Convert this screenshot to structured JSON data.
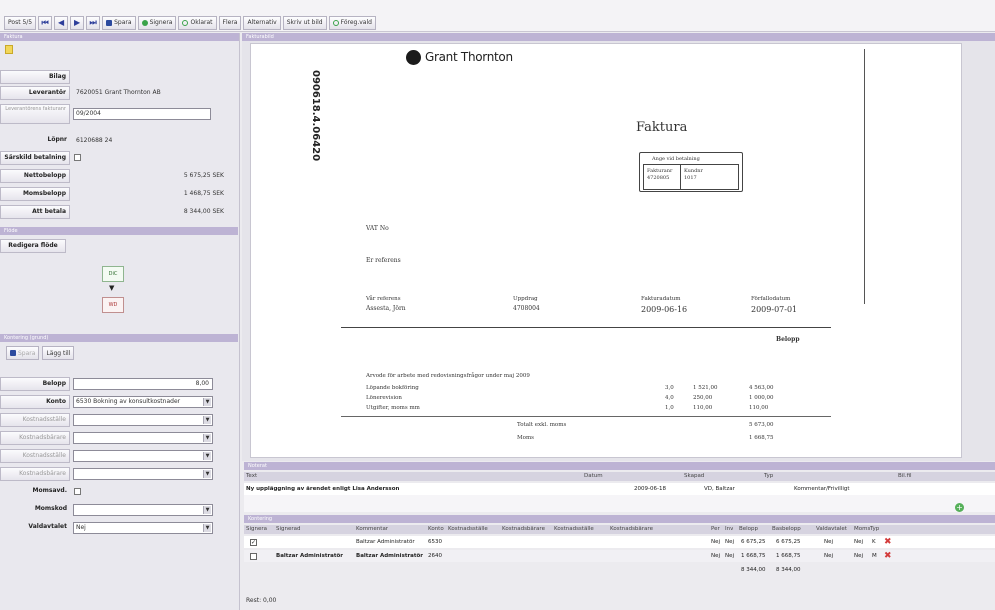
{
  "toolbar": {
    "post_label": "Post 5/5",
    "first_label": "⏮",
    "prev_label": "◀",
    "next_label": "▶",
    "last_label": "⏭",
    "save_label": "Spara",
    "signera_label": "Signera",
    "oklart_label": "Oklarat",
    "flera_label": "Flera",
    "alternativ_label": "Alternativ",
    "skriv_label": "Skriv ut bild",
    "forrige_label": "Föreg.vald"
  },
  "left": {
    "faktura_header": "Faktura",
    "bild_label": "Bilag",
    "leverantor_label": "Leverantör",
    "leverantor_value": "7620051 Grant Thornton AB",
    "levfaktnr_label": "Leverantörens fakturanr",
    "levfaktnr_value": "09/2004",
    "lopnr_label": "Löpnr",
    "lopnr_value": "6120688 24",
    "sarskild_label": "Särskild betalning",
    "netto_label": "Nettobelopp",
    "netto_value": "5 675,25 SEK",
    "moms_label": "Momsbelopp",
    "moms_value": "1 468,75 SEK",
    "att_betala_label": "Att betala",
    "att_betala_value": "8 344,00 SEK",
    "flode_header": "Flöde",
    "redigera_flode": "Redigera flöde",
    "node_top": "DiC",
    "node_bottom": "WD",
    "kontering_header": "Kontering (grund)",
    "spara_btn": "Spara",
    "lagg_till_btn": "Lägg till",
    "belopp_label": "Belopp",
    "belopp_value": "8,00",
    "konto_label": "Konto",
    "konto_value": "6530 Bokning av konsultkostnader",
    "kostnadsstalle1_label": "Kostnadsställe",
    "kostnadsbarare1_label": "Kostnadsbärare",
    "kostnadsstalle2_label": "Kostnadsställe",
    "kostnadsbarare2_label": "Kostnadsbärare",
    "momsavd_label": "Momsavd.",
    "momskod_label": "Momskod",
    "valdaskatt_label": "Valdavtalet",
    "valdaskatt_value": "Nej"
  },
  "doc_header": "Fakturabild",
  "doc": {
    "brand": "Grant Thornton",
    "side_number": "090618.4.06420",
    "title": "Faktura",
    "ange_label": "Ange vid betalning",
    "fakturanr_label": "Fakturanr",
    "fakturanr_value": "4720805",
    "kundnr_label": "Kundnr",
    "kundnr_value": "1017",
    "vat": "VAT No",
    "ref": "Er referens",
    "var_ref_label": "Vår referens",
    "var_ref_value": "Assesta, Jörn",
    "uppdrag_label": "Uppdrag",
    "uppdrag_value": "4708004",
    "fakturadatum_label": "Fakturadatum",
    "fakturadatum_value": "2009-06-16",
    "forfallodatum_label": "Förfallodatum",
    "forfallodatum_value": "2009-07-01",
    "belopp_col": "Belopp",
    "description": "Arvode för arbete med redovisningsfrågor under maj 2009",
    "lines": [
      {
        "text": "Löpande bokföring",
        "qty": "3,0",
        "price": "1 521,00",
        "sum": "4 563,00"
      },
      {
        "text": "Lönerevision",
        "qty": "4,0",
        "price": "250,00",
        "sum": "1 000,00"
      },
      {
        "text": "Utgifter, moms mm",
        "qty": "1,0",
        "price": "110,00",
        "sum": "110,00"
      }
    ],
    "total_exkl_label": "Totalt exkl. moms",
    "total_exkl_value": "5 673,00",
    "moms_label": "Moms",
    "moms_value": "1 668,75"
  },
  "notes": {
    "header": "Noterat",
    "col_text": "Text",
    "col_datum": "Datum",
    "col_skapad": "Skapad",
    "col_typ": "Typ",
    "col_bilaga": "Bil.fil",
    "row_text": "Ny uppläggning av ärendet enligt Lisa Andersson",
    "row_datum": "2009-06-18",
    "row_skapad": "VD, Baltzar",
    "row_typ": "Kommentar/Frivilligt"
  },
  "kontering": {
    "header": "Kontering",
    "columns": [
      "Signera",
      "Signerad",
      "Kommentar",
      "Konto",
      "Kostnadsställe",
      "Kostnadsbärare",
      "Kostnadsställe",
      "Kostnadsbärare",
      "Per",
      "Inv",
      "Belopp",
      "Basbelopp",
      "Valdavtalet",
      "Moms",
      "Typ"
    ],
    "rows": [
      {
        "signerad": "",
        "kommentar": "Baltzar Administratör",
        "konto": "6530",
        "per": "Nej",
        "inv": "Nej",
        "belopp": "6 675,25",
        "basbelopp": "6 675,25",
        "valdavtalet": "Nej",
        "moms": "Nej",
        "typ": "K"
      },
      {
        "signerad": "Baltzar Administratör",
        "kommentar": "Baltzar Administratör",
        "konto": "2640",
        "per": "Nej",
        "inv": "Nej",
        "belopp": "1 668,75",
        "basbelopp": "1 668,75",
        "valdavtalet": "Nej",
        "moms": "Nej",
        "typ": "M"
      }
    ],
    "total_belopp": "8 344,00",
    "total_basbelopp": "8 344,00",
    "rest_label": "Rest: 0,00"
  }
}
